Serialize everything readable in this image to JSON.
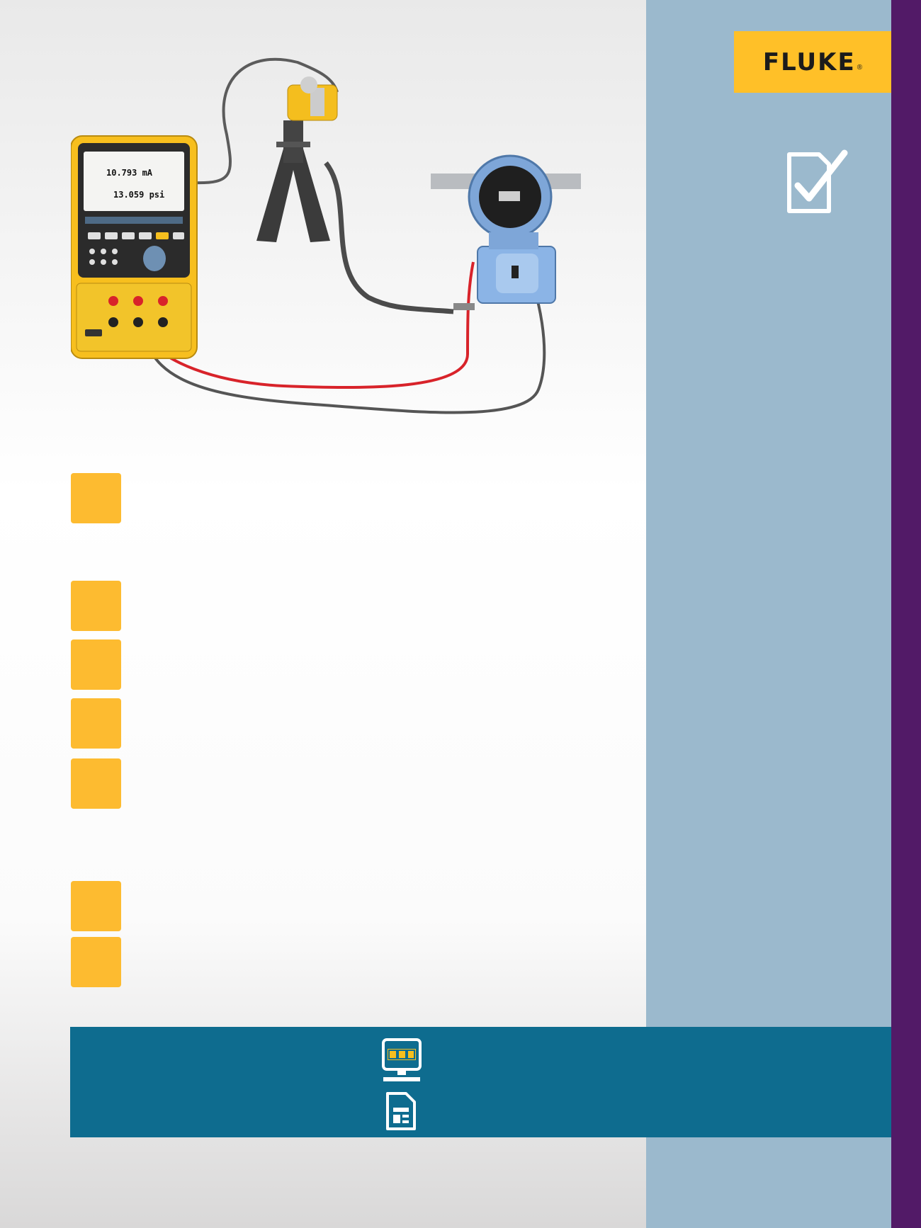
{
  "brand": {
    "logo_text": "FLUKE",
    "registered_mark": "®",
    "logo_bg": "#ffc028",
    "sidebar_color": "#9bb9cd",
    "accent_purple": "#521a67",
    "footer_band_color": "#0e6c8f",
    "step_color": "#fdbb30"
  },
  "calibrator_display": {
    "top_reading": "10.793 mA",
    "bottom_reading": "13.059 psi"
  },
  "icons": {
    "sidebar": "checklist-icon",
    "footer_top": "monitor-video-icon",
    "footer_bottom": "document-icon"
  },
  "steps": [
    {
      "id": 1
    },
    {
      "id": 2
    },
    {
      "id": 3
    },
    {
      "id": 4
    },
    {
      "id": 5
    },
    {
      "id": 6
    },
    {
      "id": 7
    }
  ]
}
